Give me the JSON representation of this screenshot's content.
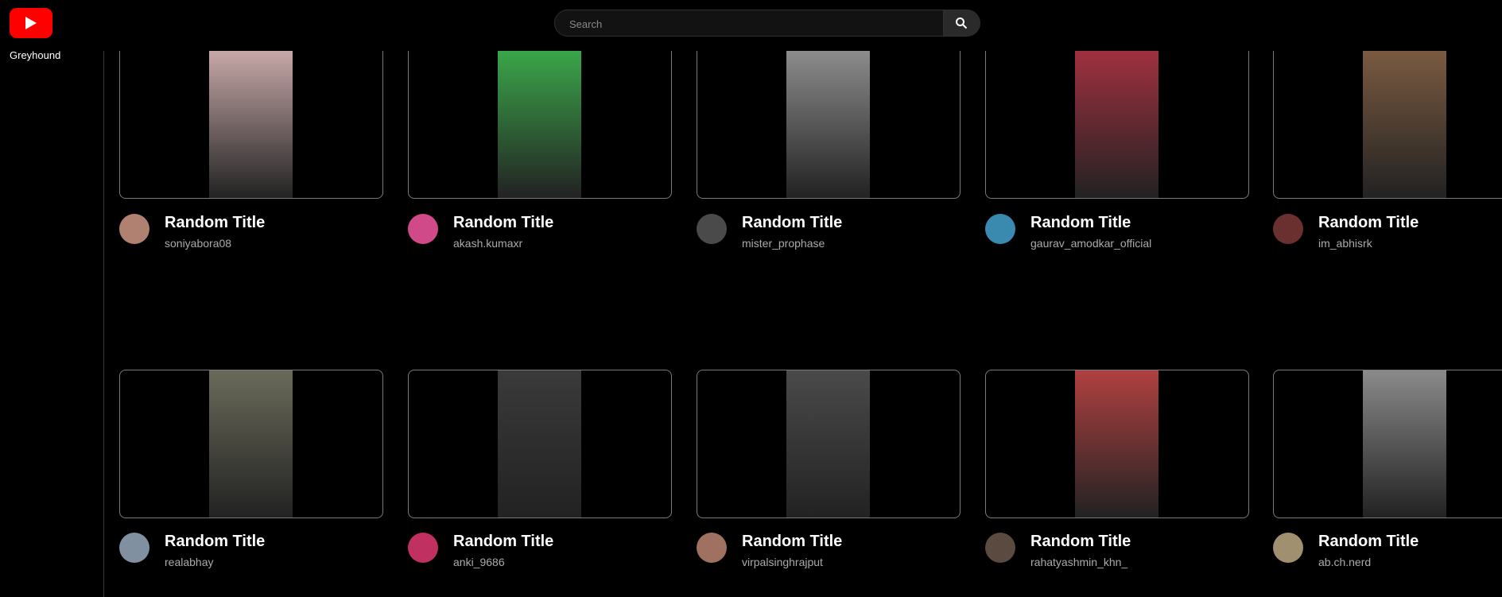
{
  "app": {
    "brand": "Greyhound"
  },
  "search": {
    "placeholder": "Search"
  },
  "videos": [
    {
      "title": "Random Title",
      "channel": "soniyabora08",
      "thumb_color": "#c7a8a8",
      "avatar_color": "#b08070"
    },
    {
      "title": "Random Title",
      "channel": "akash.kumaxr",
      "thumb_color": "#3aa64a",
      "avatar_color": "#d04a8a"
    },
    {
      "title": "Random Title",
      "channel": "mister_prophase",
      "thumb_color": "#8c8c8c",
      "avatar_color": "#4a4a4a"
    },
    {
      "title": "Random Title",
      "channel": "gaurav_amodkar_official",
      "thumb_color": "#a03040",
      "avatar_color": "#3a8ab0"
    },
    {
      "title": "Random Title",
      "channel": "im_abhisrk",
      "thumb_color": "#7a5a40",
      "avatar_color": "#6a3030"
    },
    {
      "title": "Random Title",
      "channel": "realabhay",
      "thumb_color": "#6a6a5a",
      "avatar_color": "#8090a0"
    },
    {
      "title": "Random Title",
      "channel": "anki_9686",
      "thumb_color": "#3a3a3a",
      "avatar_color": "#c03060"
    },
    {
      "title": "Random Title",
      "channel": "virpalsinghrajput",
      "thumb_color": "#4a4a4a",
      "avatar_color": "#a07060"
    },
    {
      "title": "Random Title",
      "channel": "rahatyashmin_khn_",
      "thumb_color": "#b04040",
      "avatar_color": "#5a4a40"
    },
    {
      "title": "Random Title",
      "channel": "ab.ch.nerd",
      "thumb_color": "#8a8a8a",
      "avatar_color": "#a09070"
    }
  ]
}
